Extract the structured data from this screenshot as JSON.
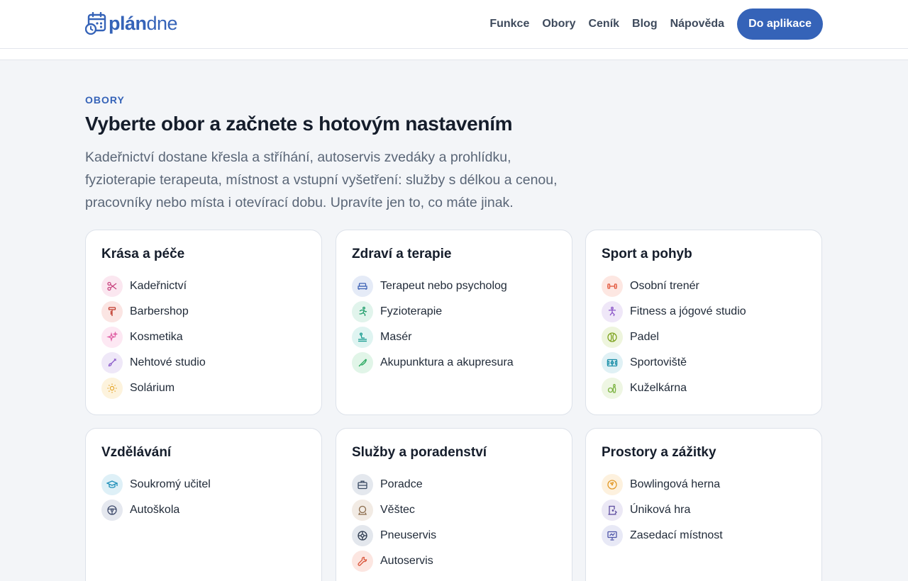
{
  "brand": {
    "name_bold": "plán",
    "name_light": "dne"
  },
  "nav": {
    "links": [
      "Funkce",
      "Obory",
      "Ceník",
      "Blog",
      "Nápověda"
    ],
    "cta": "Do aplikace"
  },
  "hero": {
    "eyebrow": "OBORY",
    "title": "Vyberte obor a začnete s hotovým nastavením",
    "lead_lines": [
      "Kadeřnictví dostane křesla a stříhání, autoservis zvedáky a prohlídku,",
      "fyzioterapie terapeuta, místnost a vstupní vyšetření: služby s délkou a cenou,",
      "pracovníky nebo místa i otevírací dobu. Upravíte jen to, co máte jinak."
    ]
  },
  "categories": [
    {
      "title": "Krása a péče",
      "items": [
        {
          "label": "Kadeřnictví",
          "icon": "scissors-icon",
          "color": "#c8447f",
          "bg": "#fbe7f0"
        },
        {
          "label": "Barbershop",
          "icon": "razor-icon",
          "color": "#c0392b",
          "bg": "#fbe5e3"
        },
        {
          "label": "Kosmetika",
          "icon": "sparkle-icon",
          "color": "#e063a6",
          "bg": "#fde8f3"
        },
        {
          "label": "Nehtové studio",
          "icon": "brush-icon",
          "color": "#8a5ac9",
          "bg": "#efe8f8"
        },
        {
          "label": "Solárium",
          "icon": "sun-icon",
          "color": "#e5a52a",
          "bg": "#fdf3dd"
        }
      ]
    },
    {
      "title": "Zdraví a terapie",
      "items": [
        {
          "label": "Terapeut nebo psycholog",
          "icon": "sofa-icon",
          "color": "#3f63b5",
          "bg": "#e5ebf7"
        },
        {
          "label": "Fyzioterapie",
          "icon": "runner-icon",
          "color": "#1f9d6a",
          "bg": "#e1f4ec"
        },
        {
          "label": "Masér",
          "icon": "massage-icon",
          "color": "#159a8f",
          "bg": "#dff4f1"
        },
        {
          "label": "Akupunktura a akupresura",
          "icon": "needle-icon",
          "color": "#23a55b",
          "bg": "#e1f5e8"
        }
      ]
    },
    {
      "title": "Sport a pohyb",
      "items": [
        {
          "label": "Osobní trenér",
          "icon": "dumbbell-icon",
          "color": "#e2553a",
          "bg": "#fde7e2"
        },
        {
          "label": "Fitness a jógové studio",
          "icon": "yoga-icon",
          "color": "#8a54c8",
          "bg": "#efe7f8"
        },
        {
          "label": "Padel",
          "icon": "ball-icon",
          "color": "#7ea21f",
          "bg": "#eef5dd"
        },
        {
          "label": "Sportoviště",
          "icon": "field-icon",
          "color": "#1b8fa8",
          "bg": "#e0f1f5"
        },
        {
          "label": "Kuželkárna",
          "icon": "pins-icon",
          "color": "#7cb342",
          "bg": "#eef6e3"
        }
      ]
    },
    {
      "title": "Vzdělávání",
      "items": [
        {
          "label": "Soukromý učitel",
          "icon": "graduation-cap-icon",
          "color": "#1e8fb9",
          "bg": "#def0f7"
        },
        {
          "label": "Autoškola",
          "icon": "steering-wheel-icon",
          "color": "#3e4a6b",
          "bg": "#e5e8ef"
        }
      ]
    },
    {
      "title": "Služby a poradenství",
      "items": [
        {
          "label": "Poradce",
          "icon": "briefcase-icon",
          "color": "#3a4a63",
          "bg": "#e4e8ee"
        },
        {
          "label": "Věštec",
          "icon": "crystal-ball-icon",
          "color": "#8a6a4a",
          "bg": "#f2ebe4"
        },
        {
          "label": "Pneuservis",
          "icon": "tire-icon",
          "color": "#2d3a4f",
          "bg": "#e3e7ed"
        },
        {
          "label": "Autoservis",
          "icon": "wrench-icon",
          "color": "#d9553b",
          "bg": "#fce6e1"
        }
      ]
    },
    {
      "title": "Prostory a zážitky",
      "items": [
        {
          "label": "Bowlingová herna",
          "icon": "bowling-ball-icon",
          "color": "#e29a2a",
          "bg": "#fdf1de"
        },
        {
          "label": "Úniková hra",
          "icon": "door-icon",
          "color": "#5b4b9e",
          "bg": "#ebe8f5"
        },
        {
          "label": "Zasedací místnost",
          "icon": "presentation-icon",
          "color": "#4e55a8",
          "bg": "#e8e9f6"
        }
      ]
    }
  ]
}
